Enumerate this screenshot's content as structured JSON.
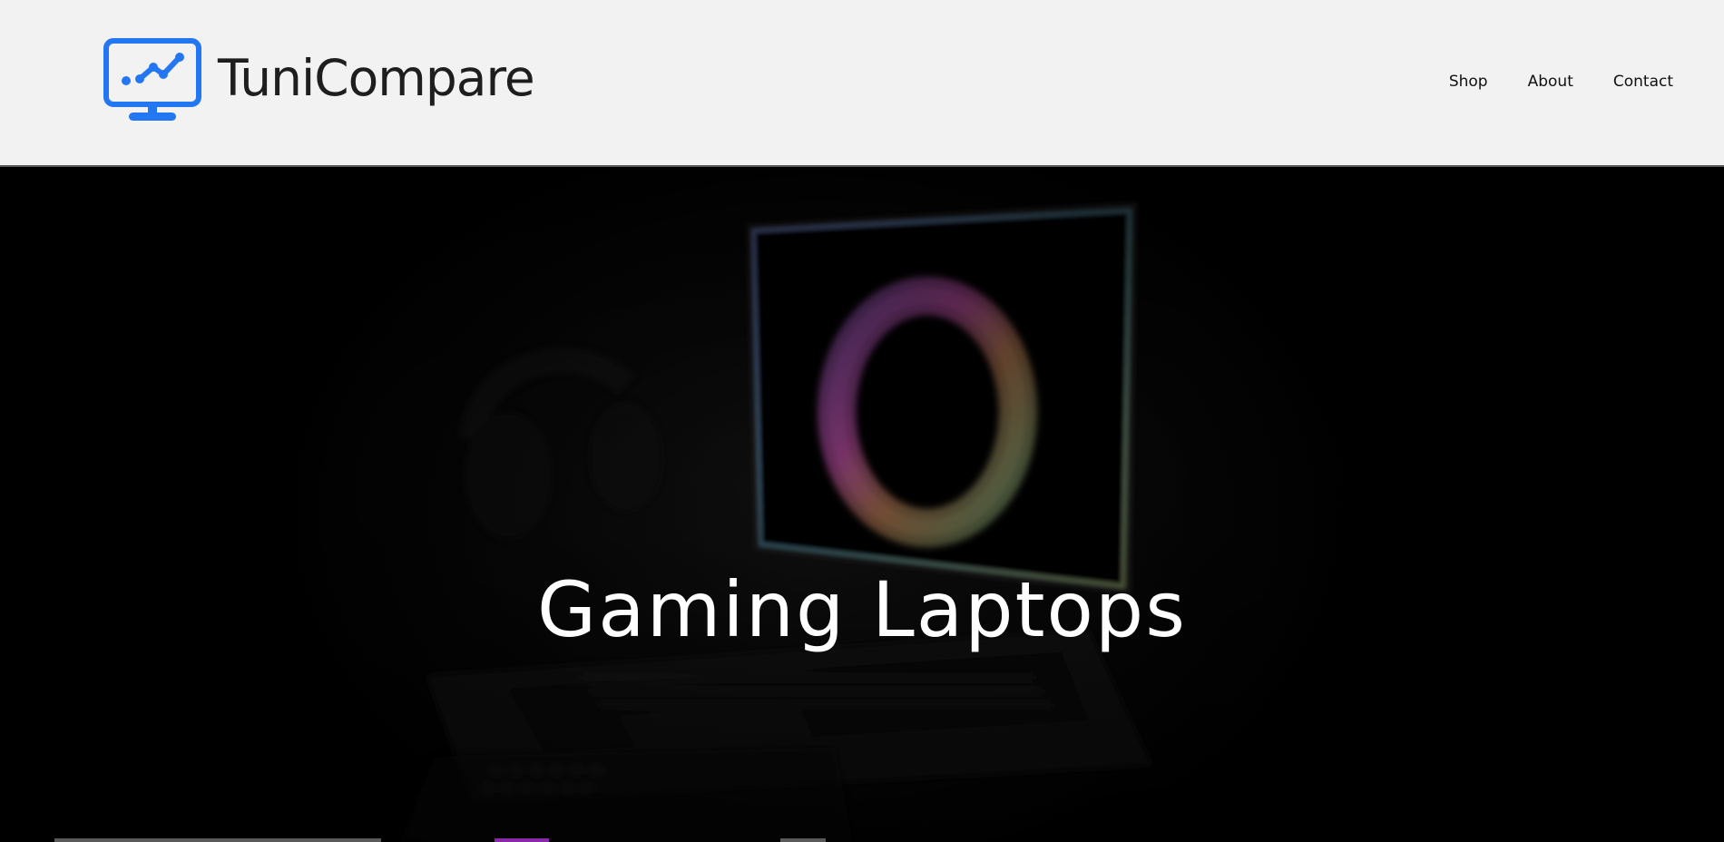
{
  "brand": {
    "name": "TuniCompare",
    "accent_color": "#2377f2",
    "icon": "monitor-chart-icon"
  },
  "nav": {
    "items": [
      {
        "label": "Shop"
      },
      {
        "label": "About"
      },
      {
        "label": "Contact"
      }
    ]
  },
  "hero": {
    "title": "Gaming Laptops",
    "background": "dark-gaming-laptop-photo"
  }
}
